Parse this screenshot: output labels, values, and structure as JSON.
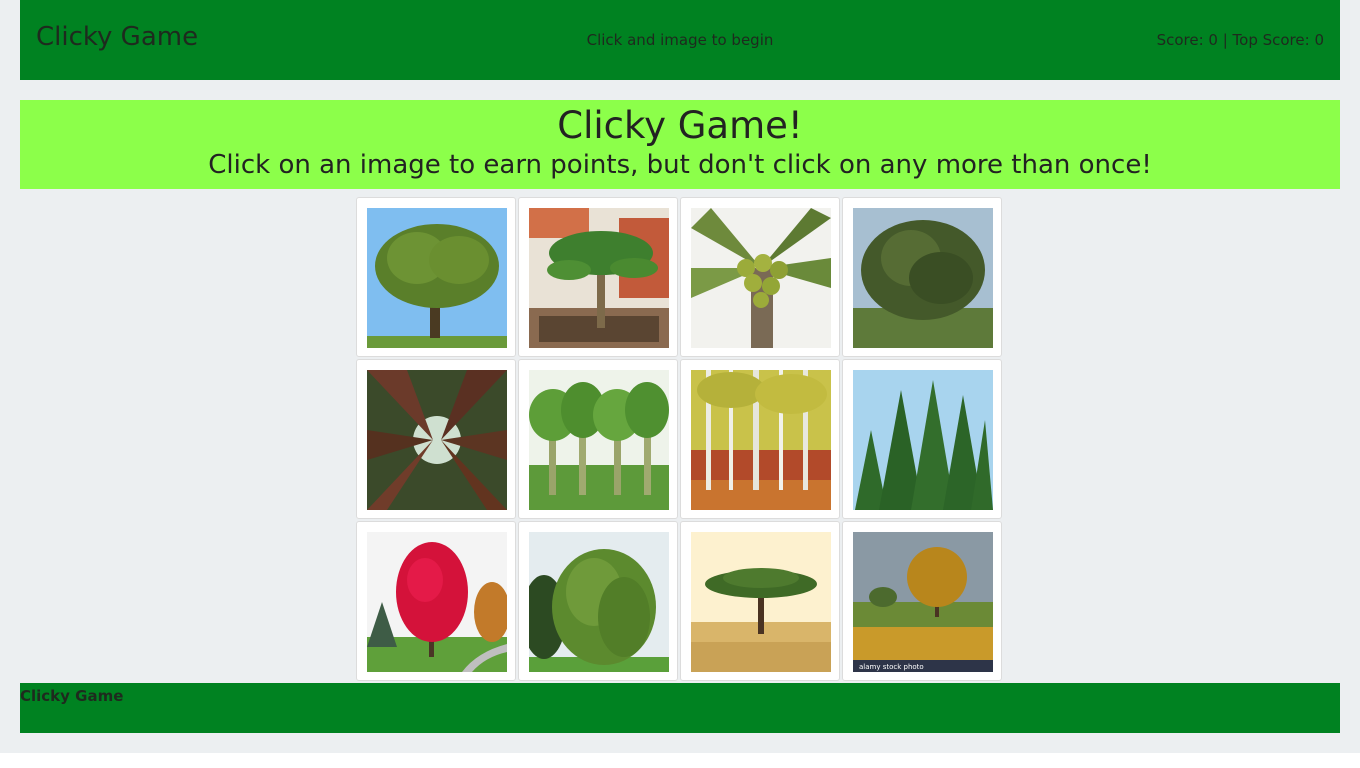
{
  "navbar": {
    "brand": "Clicky Game",
    "message": "Click and image to begin",
    "score": "Score: 0 | Top Score: 0"
  },
  "jumbotron": {
    "title": "Clicky Game!",
    "subtitle": "Click on an image to earn points, but don't click on any more than once!"
  },
  "images": [
    {
      "name": "oak-tree-image"
    },
    {
      "name": "palm-tree-image"
    },
    {
      "name": "coconut-palm-image"
    },
    {
      "name": "mango-tree-image"
    },
    {
      "name": "redwood-trees-image"
    },
    {
      "name": "banana-trees-image"
    },
    {
      "name": "birch-trees-image"
    },
    {
      "name": "pine-trees-image"
    },
    {
      "name": "red-maple-tree-image"
    },
    {
      "name": "willow-tree-image"
    },
    {
      "name": "acacia-tree-image"
    },
    {
      "name": "autumn-tree-image",
      "watermark": "alamy stock photo"
    }
  ],
  "footer": {
    "text": "Clicky Game"
  },
  "colors": {
    "navbar": "#008221",
    "jumbotron": "#8cff4a",
    "background": "#eceff1"
  }
}
